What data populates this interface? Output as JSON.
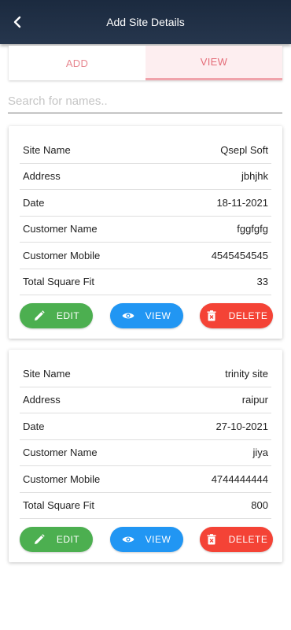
{
  "appbar": {
    "title": "Add Site Details"
  },
  "tabs": [
    {
      "label": "ADD",
      "active": false
    },
    {
      "label": "VIEW",
      "active": true
    }
  ],
  "search": {
    "placeholder": "Search for names..",
    "value": ""
  },
  "field_labels": {
    "site_name": "Site Name",
    "address": "Address",
    "date": "Date",
    "customer_name": "Customer Name",
    "customer_mobile": "Customer Mobile",
    "total_square_fit": "Total Square Fit"
  },
  "buttons": {
    "edit": "EDIT",
    "view": "VIEW",
    "delete": "DELETE"
  },
  "sites": [
    {
      "site_name": "Qsepl Soft",
      "address": "jbhjhk",
      "date": "18-11-2021",
      "customer_name": "fggfgfg",
      "customer_mobile": "4545454545",
      "total_square_fit": "33"
    },
    {
      "site_name": "trinity site",
      "address": "raipur",
      "date": "27-10-2021",
      "customer_name": "jiya",
      "customer_mobile": "4744444444",
      "total_square_fit": "800"
    }
  ],
  "colors": {
    "appbar": "#1b2a3f",
    "tab_text": "#e7868f",
    "edit": "#4caf50",
    "view": "#2196f3",
    "delete": "#f44336"
  }
}
